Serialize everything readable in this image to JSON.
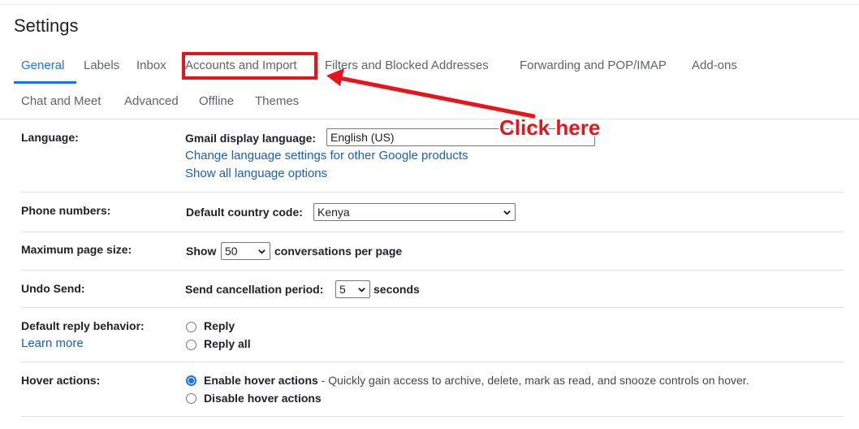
{
  "page": {
    "title": "Settings"
  },
  "tabs": [
    {
      "label": "General"
    },
    {
      "label": "Labels"
    },
    {
      "label": "Inbox"
    },
    {
      "label": "Accounts and Import"
    },
    {
      "label": "Filters and Blocked Addresses"
    },
    {
      "label": "Forwarding and POP/IMAP"
    },
    {
      "label": "Add-ons"
    },
    {
      "label": "Chat and Meet"
    },
    {
      "label": "Advanced"
    },
    {
      "label": "Offline"
    },
    {
      "label": "Themes"
    }
  ],
  "active_tab": "General",
  "language": {
    "label": "Language:",
    "display_label": "Gmail display language:",
    "value": "English (US)",
    "link1": "Change language settings for other Google products",
    "link2": "Show all language options"
  },
  "phone": {
    "label": "Phone numbers:",
    "field_label": "Default country code:",
    "value": "Kenya"
  },
  "page_size": {
    "label": "Maximum page size:",
    "prefix": "Show",
    "value": "50",
    "suffix": "conversations per page"
  },
  "undo_send": {
    "label": "Undo Send:",
    "field_label": "Send cancellation period:",
    "value": "5",
    "suffix": "seconds"
  },
  "reply": {
    "label": "Default reply behavior:",
    "learn_more": "Learn more",
    "options": [
      "Reply",
      "Reply all"
    ]
  },
  "hover": {
    "label": "Hover actions:",
    "enable": "Enable hover actions",
    "enable_desc": " - Quickly gain access to archive, delete, mark as read, and snooze controls on hover.",
    "disable": "Disable hover actions"
  },
  "annotation": {
    "text": "Click here",
    "color": "#e8141c"
  },
  "colors": {
    "accent": "#1a73e8",
    "link": "#1a5fb4"
  }
}
